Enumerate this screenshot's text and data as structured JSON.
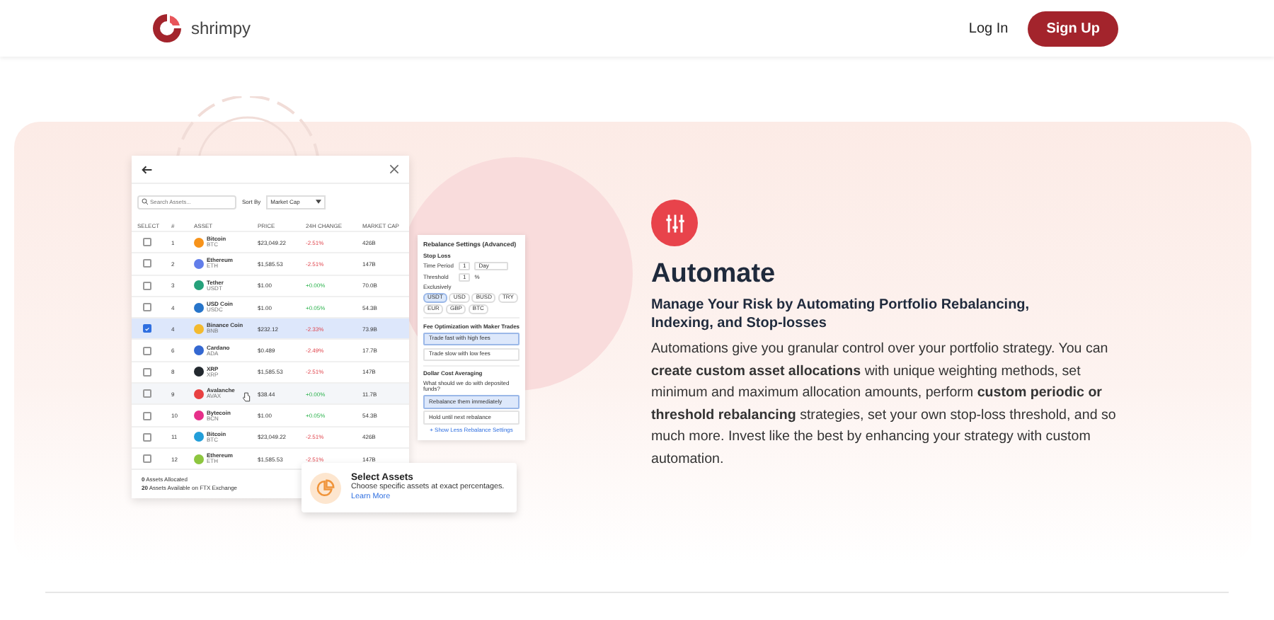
{
  "header": {
    "brand": "shrimpy",
    "login": "Log In",
    "signup": "Sign Up"
  },
  "mockup": {
    "search_placeholder": "Search Assets...",
    "sort_label": "Sort By",
    "sort_value": "Market Cap",
    "columns": [
      "SELECT",
      "#",
      "ASSET",
      "PRICE",
      "24H CHANGE",
      "MARKET CAP"
    ],
    "rows": [
      {
        "checked": false,
        "selected": false,
        "hover": false,
        "rank": "1",
        "name": "Bitcoin",
        "ticker": "BTC",
        "price": "$23,049.22",
        "change": "-2.51%",
        "kind": "loss",
        "cap": "426B",
        "color": "#f7931a"
      },
      {
        "checked": false,
        "selected": false,
        "hover": false,
        "rank": "2",
        "name": "Ethereum",
        "ticker": "ETH",
        "price": "$1,585.53",
        "change": "-2.51%",
        "kind": "loss",
        "cap": "147B",
        "color": "#627eea"
      },
      {
        "checked": false,
        "selected": false,
        "hover": false,
        "rank": "3",
        "name": "Tether",
        "ticker": "USDT",
        "price": "$1.00",
        "change": "+0.00%",
        "kind": "gain",
        "cap": "70.0B",
        "color": "#26a17b"
      },
      {
        "checked": false,
        "selected": false,
        "hover": false,
        "rank": "4",
        "name": "USD Coin",
        "ticker": "USDC",
        "price": "$1.00",
        "change": "+0.05%",
        "kind": "gain",
        "cap": "54.3B",
        "color": "#2775ca"
      },
      {
        "checked": true,
        "selected": true,
        "hover": false,
        "rank": "4",
        "name": "Binance Coin",
        "ticker": "BNB",
        "price": "$232.12",
        "change": "-2.33%",
        "kind": "loss",
        "cap": "73.9B",
        "color": "#f3ba2f"
      },
      {
        "checked": false,
        "selected": false,
        "hover": false,
        "rank": "6",
        "name": "Cardano",
        "ticker": "ADA",
        "price": "$0.489",
        "change": "-2.49%",
        "kind": "loss",
        "cap": "17.7B",
        "color": "#3468d1"
      },
      {
        "checked": false,
        "selected": false,
        "hover": false,
        "rank": "8",
        "name": "XRP",
        "ticker": "XRP",
        "price": "$1,585.53",
        "change": "-2.51%",
        "kind": "loss",
        "cap": "147B",
        "color": "#23292f"
      },
      {
        "checked": false,
        "selected": false,
        "hover": true,
        "rank": "9",
        "name": "Avalanche",
        "ticker": "AVAX",
        "price": "$38.44",
        "change": "+0.00%",
        "kind": "gain",
        "cap": "11.7B",
        "color": "#e84142"
      },
      {
        "checked": false,
        "selected": false,
        "hover": false,
        "rank": "10",
        "name": "Bytecoin",
        "ticker": "BCN",
        "price": "$1.00",
        "change": "+0.05%",
        "kind": "gain",
        "cap": "54.3B",
        "color": "#e6308a"
      },
      {
        "checked": false,
        "selected": false,
        "hover": false,
        "rank": "11",
        "name": "Bitcoin",
        "ticker": "BTC",
        "price": "$23,049.22",
        "change": "-2.51%",
        "kind": "loss",
        "cap": "426B",
        "color": "#229ed9"
      },
      {
        "checked": false,
        "selected": false,
        "hover": false,
        "rank": "12",
        "name": "Ethereum",
        "ticker": "ETH",
        "price": "$1,585.53",
        "change": "-2.51%",
        "kind": "loss",
        "cap": "147B",
        "color": "#8dc63f"
      }
    ],
    "footer": [
      "**0** Assets Allocated",
      "**20** Assets Available on FTX Exchange"
    ]
  },
  "settings": {
    "title": "Rebalance Settings (Advanced)",
    "stop_loss": "Stop Loss",
    "time_label": "Time Period",
    "time_value": "1",
    "time_unit": "Day",
    "threshold_label": "Threshold",
    "threshold_value": "1",
    "threshold_unit": "%",
    "currency_label": "Exclusively",
    "chips": [
      {
        "label": "USDT",
        "selected": true
      },
      {
        "label": "USD",
        "selected": false
      },
      {
        "label": "BUSD",
        "selected": false
      },
      {
        "label": "TRY",
        "selected": false
      },
      {
        "label": "EUR",
        "selected": false
      },
      {
        "label": "GBP",
        "selected": false
      },
      {
        "label": "BTC",
        "selected": false
      }
    ],
    "fee_title": "Fee Optimization with Maker Trades",
    "fee_options": [
      {
        "label": "Trade fast with high fees",
        "selected": true
      },
      {
        "label": "Trade slow with low fees",
        "selected": false
      }
    ],
    "dca_title": "Dollar Cost Averaging",
    "dca_question": "What should we do with deposited funds?",
    "dca_options": [
      {
        "label": "Rebalance them immediately",
        "selected": true
      },
      {
        "label": "Hold until next rebalance",
        "selected": false
      }
    ],
    "toggle": "+ Show Less Rebalance Settings"
  },
  "callout": {
    "title": "Select Assets",
    "text": "Choose specific assets at exact percentages.",
    "link": "Learn More"
  },
  "feature": {
    "title": "Automate",
    "subtitle": "Manage Your Risk by Automating Portfolio Rebalancing, Indexing, and Stop-losses",
    "body": "Automations give you granular control over your portfolio strategy. You can **create custom asset allocations** with unique weighting methods, set minimum and maximum allocation amounts, perform **custom periodic or threshold rebalancing** strategies, set your own stop-loss threshold, and so much more. Invest like the best by enhancing your strategy with custom automation."
  }
}
